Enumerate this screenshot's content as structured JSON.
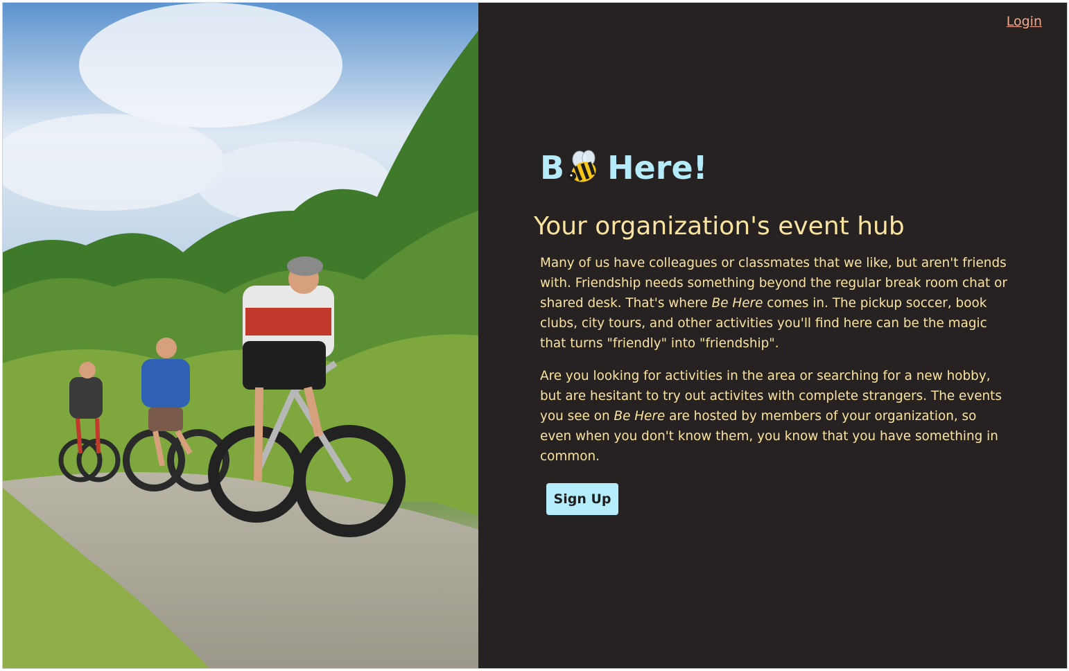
{
  "nav": {
    "login_label": "Login"
  },
  "brand": {
    "prefix": "B",
    "icon": "bee-icon",
    "suffix": "Here!"
  },
  "hero": {
    "tagline": "Your organization's event hub",
    "paragraph1": {
      "before": "Many of us have colleagues or classmates that we like, but aren't friends with. Friendship needs something beyond the regular break room chat or shared desk. That's where ",
      "emphasis": "Be Here",
      "after": " comes in. The pickup soccer, book clubs, city tours, and other activities you'll find here can be the magic that turns \"friendly\" into \"friendship\"."
    },
    "paragraph2": {
      "before": "Are you looking for activities in the area or searching for a new hobby, but are hesitant to try out activites with complete strangers. The events you see on ",
      "emphasis": "Be Here",
      "after": " are hosted by members of your organization, so even when you don't know them, you know that you have something in common."
    },
    "signup_label": "Sign Up"
  },
  "photo": {
    "subject": "cyclists-on-trail-image"
  },
  "colors": {
    "panel_bg": "#272222",
    "brand": "#b4ecfb",
    "text": "#fbe3a0",
    "login": "#f4a98c",
    "button_bg": "#b4ecfb"
  }
}
